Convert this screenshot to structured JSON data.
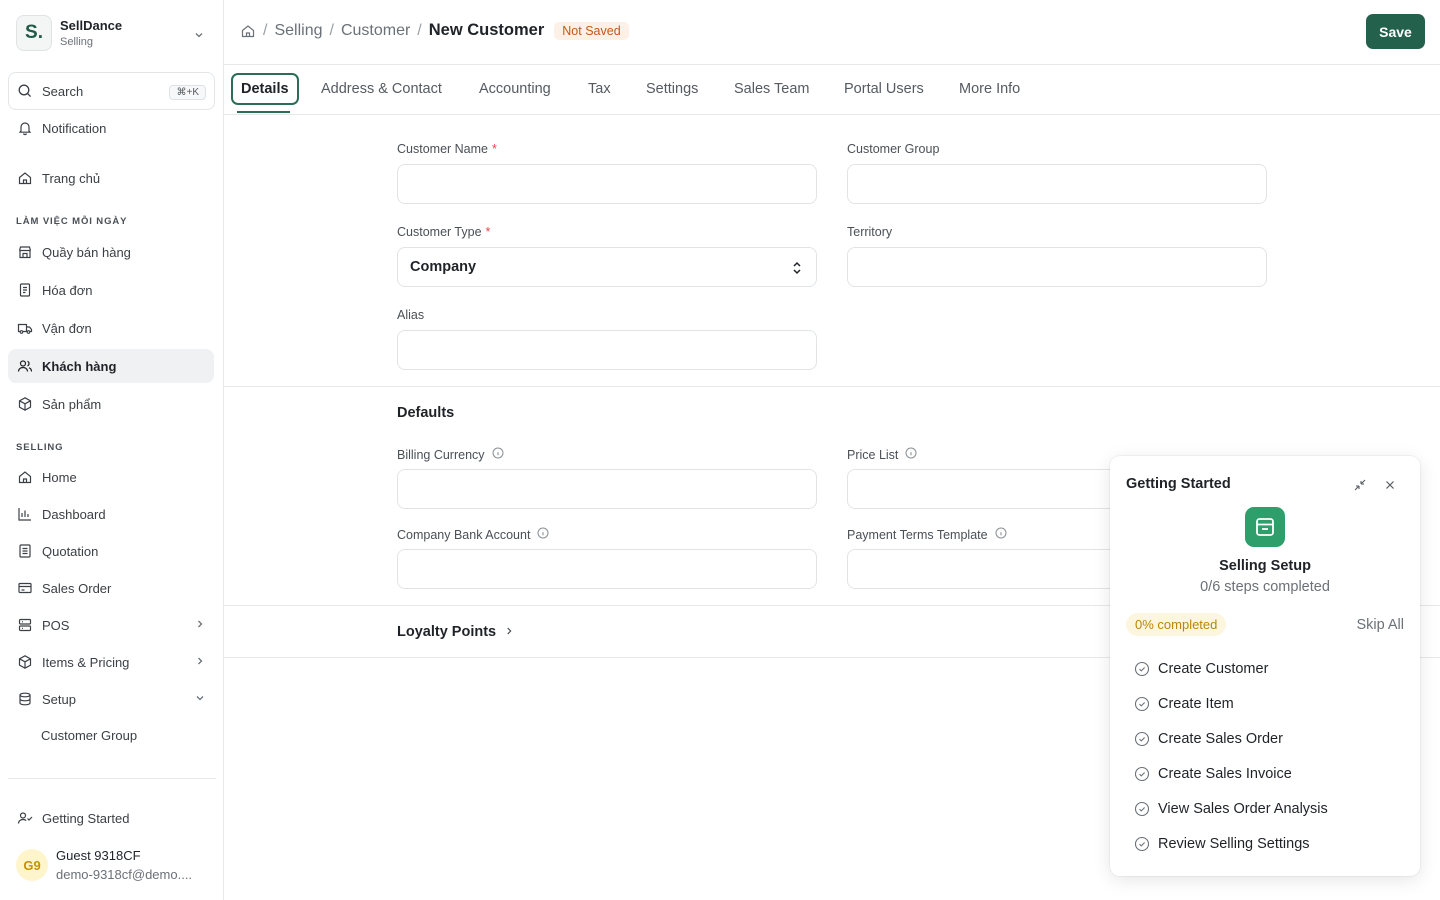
{
  "brand": {
    "logo": "S.",
    "name": "SellDance",
    "subtitle": "Selling"
  },
  "search": {
    "label": "Search",
    "shortcut": "⌘+K"
  },
  "sidebar": {
    "notification": "Notification",
    "home_vn": "Trang chủ",
    "section_daily": "LÀM VIỆC MỖI NGÀY",
    "daily_items": [
      "Quầy bán hàng",
      "Hóa đơn",
      "Vận đơn",
      "Khách hàng",
      "Sản phẩm"
    ],
    "section_selling": "SELLING",
    "selling_items": [
      "Home",
      "Dashboard",
      "Quotation",
      "Sales Order",
      "POS",
      "Items & Pricing",
      "Setup"
    ],
    "setup_sub": "Customer Group",
    "getting_started": "Getting Started"
  },
  "user": {
    "initials": "G9",
    "name": "Guest 9318CF",
    "email": "demo-9318cf@demo...."
  },
  "breadcrumb": {
    "items": [
      "Selling",
      "Customer"
    ],
    "current": "New Customer",
    "status": "Not Saved"
  },
  "toolbar": {
    "save_label": "Save"
  },
  "tabs": [
    "Details",
    "Address & Contact",
    "Accounting",
    "Tax",
    "Settings",
    "Sales Team",
    "Portal Users",
    "More Info"
  ],
  "form": {
    "customer_name": "Customer Name",
    "customer_group": "Customer Group",
    "customer_type": "Customer Type",
    "customer_type_value": "Company",
    "territory": "Territory",
    "alias": "Alias",
    "defaults_title": "Defaults",
    "billing_currency": "Billing Currency",
    "price_list": "Price List",
    "company_bank_account": "Company Bank Account",
    "payment_terms_template": "Payment Terms Template",
    "loyalty_points": "Loyalty Points",
    "required_mark": "*"
  },
  "getting_started": {
    "title": "Getting Started",
    "setup_name": "Selling Setup",
    "steps_text": "0/6 steps completed",
    "progress_label": "0% completed",
    "progress_fraction": 0,
    "skip_label": "Skip All",
    "steps": [
      "Create Customer",
      "Create Item",
      "Create Sales Order",
      "Create Sales Invoice",
      "View Sales Order Analysis",
      "Review Selling Settings"
    ]
  },
  "colors": {
    "accent": "#24614d",
    "status_bg": "#fdf0e6",
    "status_text": "#c05a1a",
    "progress_bg": "#fdf6df",
    "progress_text": "#b8860b",
    "logo_green": "#2e9e6b"
  }
}
